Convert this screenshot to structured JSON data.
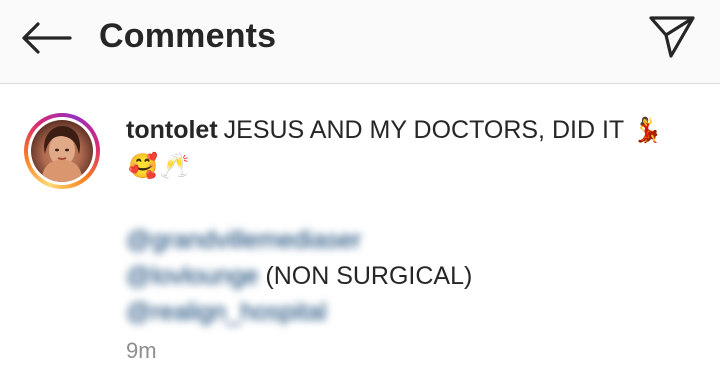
{
  "header": {
    "title": "Comments",
    "back_icon": "arrow-left-icon",
    "share_icon": "paper-plane-icon"
  },
  "comment": {
    "username": "tontolet",
    "text": "JESUS AND MY DOCTORS, DID IT",
    "emojis": [
      "💃",
      "🥰",
      "🥂"
    ],
    "mentions": [
      {
        "handle": "@grandvillemediaser",
        "suffix": ""
      },
      {
        "handle": "@lovlounge",
        "suffix": " (NON SURGICAL)"
      },
      {
        "handle": "@realign_hospital",
        "suffix": ""
      }
    ],
    "timestamp": "9m"
  },
  "colors": {
    "text": "#262626",
    "muted": "#8e8e8e",
    "mention": "#00376b",
    "header_bg": "#fafafa"
  }
}
